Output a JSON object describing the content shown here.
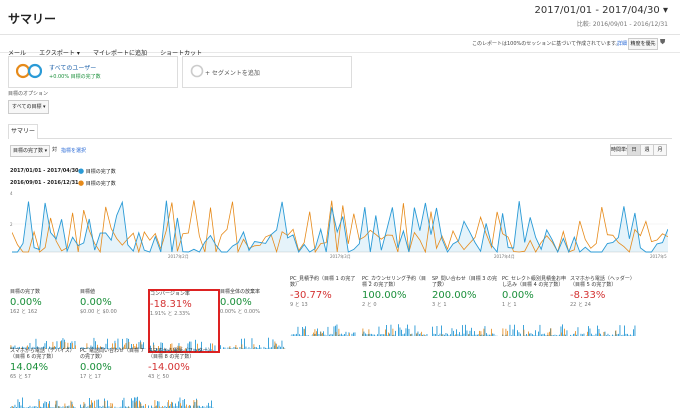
{
  "header": {
    "title": "サマリー",
    "date_range": "2017/01/01 - 2017/04/30",
    "compare_range": "比較: 2016/09/01 - 2016/12/31"
  },
  "toolbar": {
    "items": [
      "メール",
      "エクスポート ▾",
      "マイレポートに追加",
      "ショートカット"
    ],
    "notice": "このレポートは100%のセッションに基づいて作成されています。",
    "detail": "詳細",
    "quality": "精度を優先"
  },
  "segments": {
    "all_users": "すべてのユーザー",
    "all_users_sub": "+0.00% 目標の完了数",
    "add_segment": "+ セグメントを追加"
  },
  "goal_option": {
    "label": "目標のオプション",
    "select": "すべての目標"
  },
  "tabs": {
    "summary": "サマリー"
  },
  "controls": {
    "metric_select": "目標の完了数",
    "vs": "対",
    "select_metric": "指標を選択",
    "view_buttons": [
      "時間単位",
      "日",
      "週",
      "月"
    ]
  },
  "legend": {
    "r1_date": "2017/01/01 - 2017/04/30:",
    "r1_label": "目標の完了数",
    "r2_date": "2016/09/01 - 2016/12/31:",
    "r2_label": "目標の完了数"
  },
  "axis": {
    "y_top": "4",
    "y_mid": "2",
    "x_labels": [
      "2017年2月",
      "2017年3月",
      "2017年4月",
      "2017年5"
    ]
  },
  "colors": {
    "primary": "#2a9ad6",
    "secondary": "#e68a1a",
    "up": "#1a8f3a",
    "down": "#d43333"
  },
  "cards": [
    {
      "label": "目標の完了数",
      "value": "0.00%",
      "sub": "162 と 162",
      "color": "green",
      "highlight": false
    },
    {
      "label": "目標値",
      "value": "0.00%",
      "sub": "$0.00 と $0.00",
      "color": "green",
      "highlight": false
    },
    {
      "label": "コンバージョン率",
      "value": "-18.31%",
      "sub": "1.91% と 2.33%",
      "color": "red",
      "highlight": true
    },
    {
      "label": "目標全体の放棄率",
      "value": "0.00%",
      "sub": "0.00% と 0.00%",
      "color": "green",
      "highlight": false
    },
    {
      "label": "PC_見積予約（目標 1 の完了数）",
      "value": "-30.77%",
      "sub": "9 と 13",
      "color": "red",
      "highlight": false
    },
    {
      "label": "PC_カウンセリング予約（目標 2 の完了数）",
      "value": "100.00%",
      "sub": "2 と 0",
      "color": "green",
      "highlight": false
    },
    {
      "label": "SP_問い合わせ（目標 3 の完了数）",
      "value": "200.00%",
      "sub": "3 と 1",
      "color": "green",
      "highlight": false
    },
    {
      "label": "PC_セレクト級別見積金お申し込み（目標 4 の完了数）",
      "value": "0.00%",
      "sub": "1 と 1",
      "color": "green",
      "highlight": false
    },
    {
      "label": "スマホから電話（ヘッダー）（目標 5 の完了数）",
      "value": "-8.33%",
      "sub": "22 と 24",
      "color": "red",
      "highlight": false
    },
    {
      "label": "スマホから電話（デバイス）（目標 6 の完了数）",
      "value": "14.04%",
      "sub": "65 と 57",
      "color": "green",
      "highlight": false
    },
    {
      "label": "PC_電話問い合わせ（目標 7 の完了数）",
      "value": "0.00%",
      "sub": "17 と 17",
      "color": "green",
      "highlight": false
    },
    {
      "label": "スマホから電話（フッター）（目標 8 の完了数）",
      "value": "-14.00%",
      "sub": "43 と 50",
      "color": "red",
      "highlight": false
    }
  ]
}
